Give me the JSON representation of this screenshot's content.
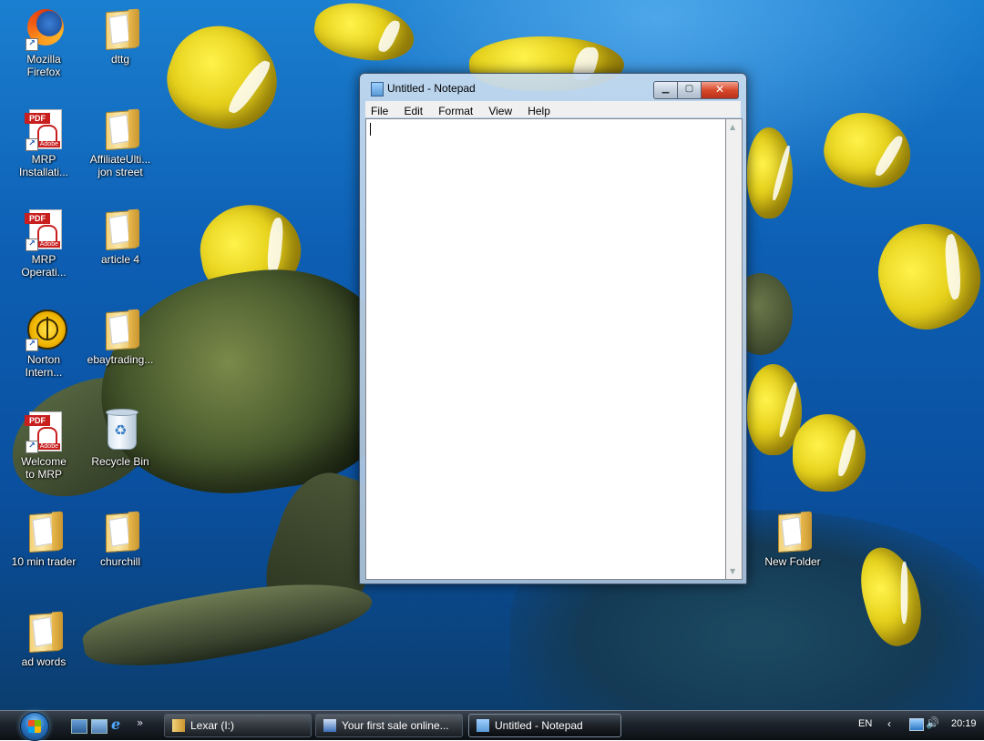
{
  "desktop": {
    "icons": [
      {
        "label": "Mozilla Firefox",
        "icon": "firefox-icon"
      },
      {
        "label": "dttg",
        "icon": "folder-icon"
      },
      {
        "label": "MRP Installati...",
        "icon": "pdf-icon"
      },
      {
        "label": "AffiliateUlti... jon street",
        "icon": "folder-icon"
      },
      {
        "label": "MRP Operati...",
        "icon": "pdf-icon"
      },
      {
        "label": "article 4",
        "icon": "folder-icon"
      },
      {
        "label": "Norton Intern...",
        "icon": "norton-icon"
      },
      {
        "label": "ebaytrading...",
        "icon": "folder-icon"
      },
      {
        "label": "Welcome to MRP",
        "icon": "pdf-icon"
      },
      {
        "label": "Recycle Bin",
        "icon": "recycle-bin-icon"
      },
      {
        "label": "10 min trader",
        "icon": "folder-icon"
      },
      {
        "label": "churchill",
        "icon": "folder-icon"
      },
      {
        "label": "ad words",
        "icon": "folder-icon"
      },
      {
        "label": "New Folder",
        "icon": "folder-icon"
      }
    ],
    "pdf_tag": "PDF",
    "pdf_brand": "Adobe"
  },
  "notepad": {
    "title": "Untitled - Notepad",
    "menu": [
      "File",
      "Edit",
      "Format",
      "View",
      "Help"
    ],
    "content": ""
  },
  "taskbar": {
    "tasks": [
      {
        "label": "Lexar (I:)"
      },
      {
        "label": "Your first sale online..."
      },
      {
        "label": "Untitled - Notepad",
        "active": true
      }
    ],
    "quick_launch_more": "»",
    "tray": {
      "language": "EN",
      "clock": "20:19"
    }
  },
  "colors": {
    "taskbar": "#1c232b",
    "desktop_water": "#0d5fb4",
    "close_button": "#d8492b"
  }
}
